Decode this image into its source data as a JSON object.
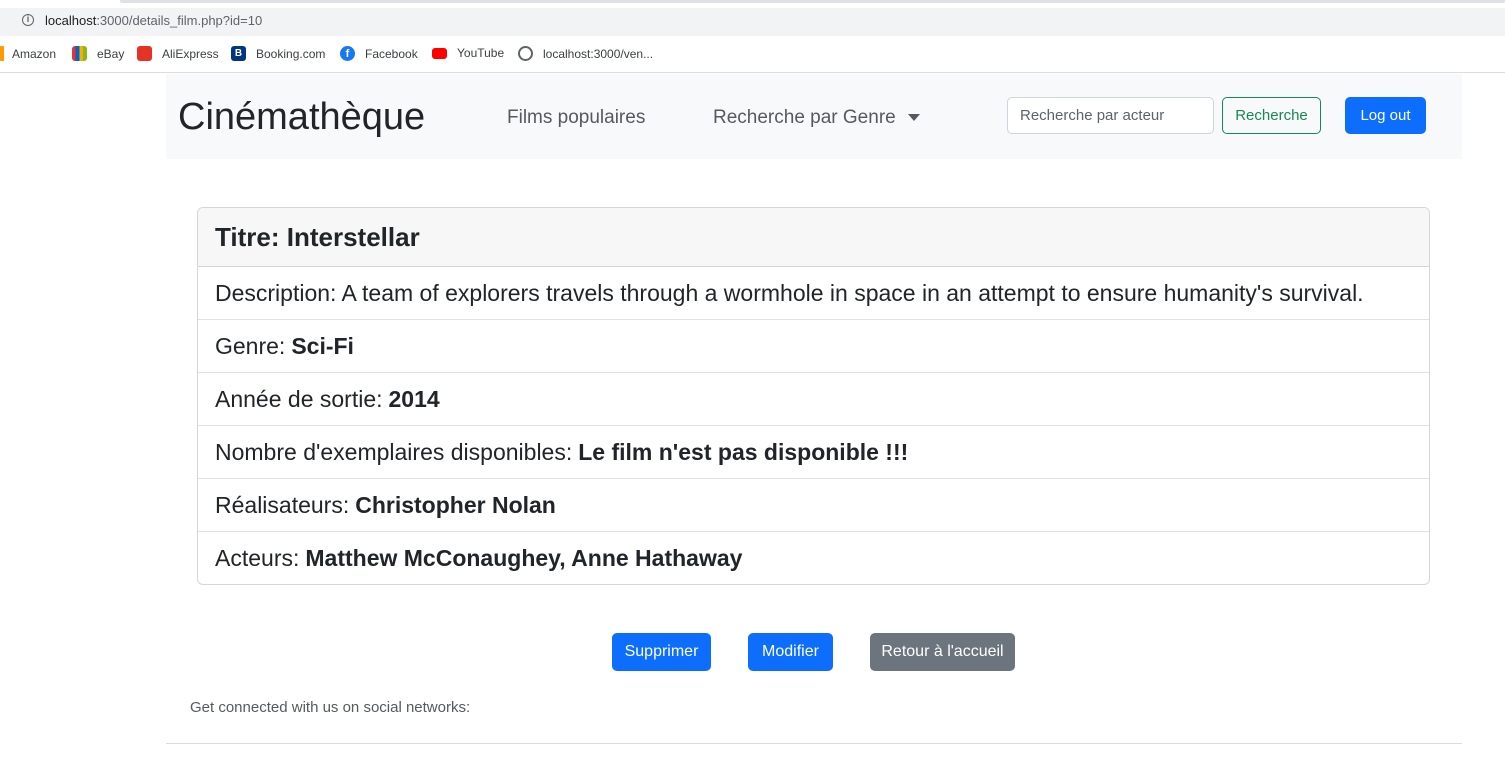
{
  "browser": {
    "url_host": "localhost",
    "url_rest": ":3000/details_film.php?id=10",
    "bookmarks": [
      {
        "label": "Amazon",
        "icon": "amazon-icon",
        "color": "#ff9900"
      },
      {
        "label": "eBay",
        "icon": "ebay-icon",
        "color": "#e53238"
      },
      {
        "label": "AliExpress",
        "icon": "aliexpress-icon",
        "color": "#e43225"
      },
      {
        "label": "Booking.com",
        "icon": "booking-icon",
        "color": "#003580"
      },
      {
        "label": "Facebook",
        "icon": "facebook-icon",
        "color": "#1877f2"
      },
      {
        "label": "YouTube",
        "icon": "youtube-icon",
        "color": "#ff0000"
      },
      {
        "label": "localhost:3000/ven...",
        "icon": "globe-icon",
        "color": "#5f6368"
      }
    ]
  },
  "navbar": {
    "brand": "Cinémathèque",
    "links": [
      "Films populaires",
      "Recherche par Genre"
    ],
    "search_placeholder": "Recherche par acteur",
    "search_button": "Recherche",
    "logout_button": "Log out"
  },
  "film": {
    "title_label": "Titre: Interstellar",
    "description": "Description: A team of explorers travels through a wormhole in space in an attempt to ensure humanity's survival.",
    "genre_label": "Genre:",
    "genre_value": "Sci-Fi",
    "year_label": "Année de sortie:",
    "year_value": "2014",
    "copies_label": "Nombre d'exemplaires disponibles:",
    "copies_value": "Le film n'est pas disponible !!!",
    "directors_label": "Réalisateurs:",
    "directors_value": "Christopher Nolan",
    "actors_label": "Acteurs:",
    "actors_value": "Matthew McConaughey, Anne Hathaway"
  },
  "actions": {
    "delete": "Supprimer",
    "edit": "Modifier",
    "home": "Retour à l'accueil"
  },
  "footer": {
    "social_text": "Get connected with us on social networks:"
  },
  "colors": {
    "primary": "#0d6efd",
    "success": "#198754",
    "secondary": "#6c757d",
    "navbar_bg": "#f8f9fa"
  }
}
